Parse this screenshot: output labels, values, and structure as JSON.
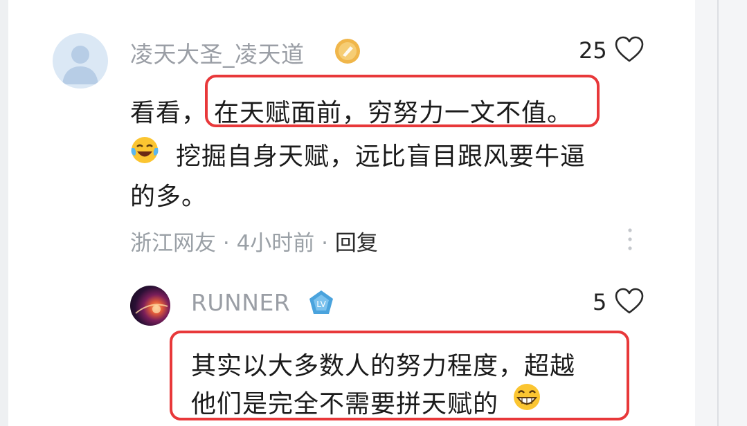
{
  "comment": {
    "username": "凌天大圣_凌天道",
    "badge_icon": "gold-level-badge-icon",
    "like_count": "25",
    "body": {
      "prefix": "看看，",
      "highlighted": "在天赋面前，穷努力一文不值。",
      "emoji_icon": "laugh-cry-emoji-icon",
      "line2": "挖掘自身天赋，远比盲目跟风要牛逼",
      "line3": "的多。"
    },
    "meta": {
      "location": "浙江网友",
      "dot1": "·",
      "time": "4小时前",
      "dot2": "·",
      "reply": "回复"
    }
  },
  "reply": {
    "username": "RUNNER",
    "badge_icon": "blue-level-badge-icon",
    "like_count": "5",
    "body": {
      "line1": "其实以大多数人的努力程度，超越",
      "line2": "他们是完全不需要拼天赋的",
      "emoji_icon": "grin-emoji-icon"
    }
  },
  "colors": {
    "highlight_box": "#e8383a",
    "username": "#9a9ea5",
    "body_text": "#1b1b1b",
    "meta_text": "#9aa0a6"
  }
}
